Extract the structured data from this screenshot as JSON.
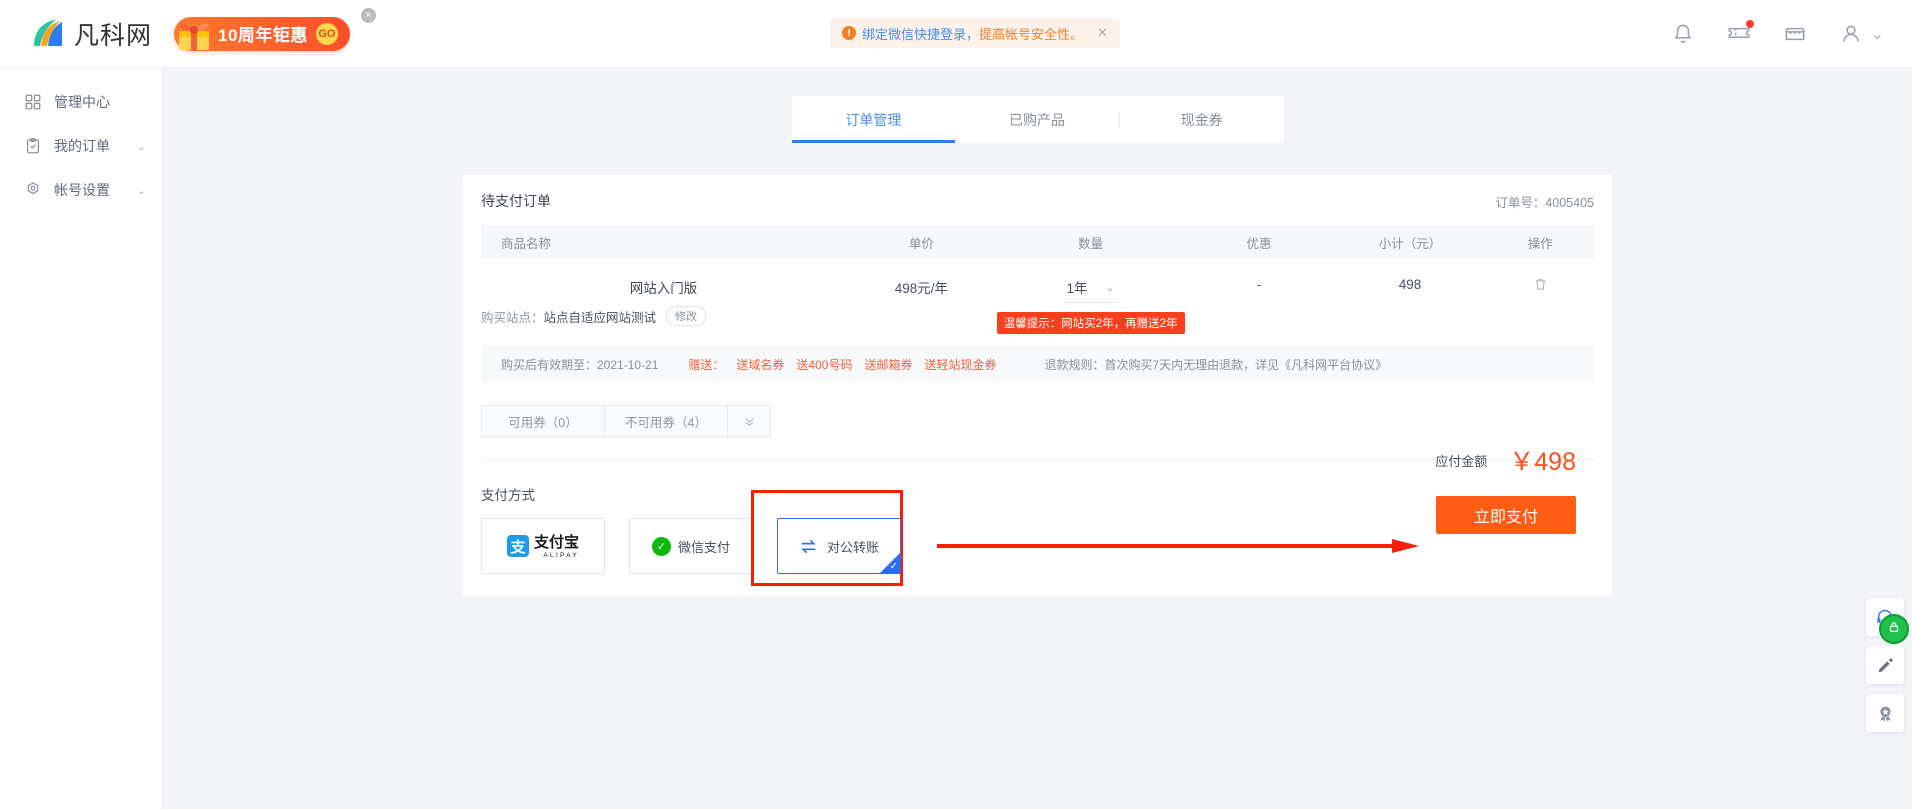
{
  "header": {
    "brand_name": "凡科网",
    "promo_text": "10周年钜惠",
    "promo_go": "GO",
    "promo_close": "×",
    "notice_link": "绑定微信快捷登录，",
    "notice_rest": "提高帐号安全性。",
    "notice_icon": "!",
    "notice_close": "✕"
  },
  "sidebar": {
    "items": [
      {
        "label": "管理中心",
        "icon": "grid-icon",
        "chevron": ""
      },
      {
        "label": "我的订单",
        "icon": "clipboard-check-icon",
        "chevron": "⌄"
      },
      {
        "label": "帐号设置",
        "icon": "gear-icon",
        "chevron": "⌄"
      }
    ]
  },
  "tabs": [
    {
      "label": "订单管理",
      "active": true
    },
    {
      "label": "已购产品",
      "active": false
    },
    {
      "label": "现金券",
      "active": false
    }
  ],
  "order": {
    "card_title": "待支付订单",
    "order_no": "订单号：4005405",
    "columns": [
      "商品名称",
      "单价",
      "数量",
      "优惠",
      "小计（元）",
      "操作"
    ],
    "item": {
      "name": "网站入门版",
      "site_label": "购买站点：",
      "site_value": "站点自适应网站测试",
      "edit_badge": "修改",
      "unit_price": "498元/年",
      "quantity": "1年",
      "quantity_chevron": "⌄",
      "discount": "-",
      "subtotal": "498",
      "delete_icon": "trash-icon",
      "tip": "温馨提示：网站买2年，再赠送2年"
    },
    "footer": {
      "validity": "购买后有效期至：2021-10-21",
      "gift_label": "赠送：",
      "gifts": [
        "送域名券",
        "送400号码",
        "送邮箱券",
        "送轻站现金券"
      ],
      "rules": "退款规则：首次购买7天内无理由退款，详见《凡科网平台协议》"
    },
    "coupons": {
      "available": "可用券（0）",
      "unavailable": "不可用券（4）",
      "expand": "⌄"
    }
  },
  "payment": {
    "title": "支付方式",
    "methods": [
      {
        "name": "支付宝",
        "sub": "ALIPAY",
        "symbol": "支",
        "selected": false
      },
      {
        "name": "微信支付",
        "icon": "wechat-check-icon",
        "selected": false
      },
      {
        "name": "对公转账",
        "icon": "transfer-icon",
        "selected": true
      }
    ],
    "amount_label": "应付金额",
    "amount_value": "￥498",
    "pay_button": "立即支付"
  },
  "floaters": [
    {
      "icon": "headset-icon"
    },
    {
      "icon": "pencil-icon"
    },
    {
      "icon": "award-icon"
    }
  ],
  "colors": {
    "accent_blue": "#2d7ff0",
    "accent_orange": "#ff5c14",
    "tip_red": "#f8401f",
    "annotation_red": "#f81f09"
  }
}
